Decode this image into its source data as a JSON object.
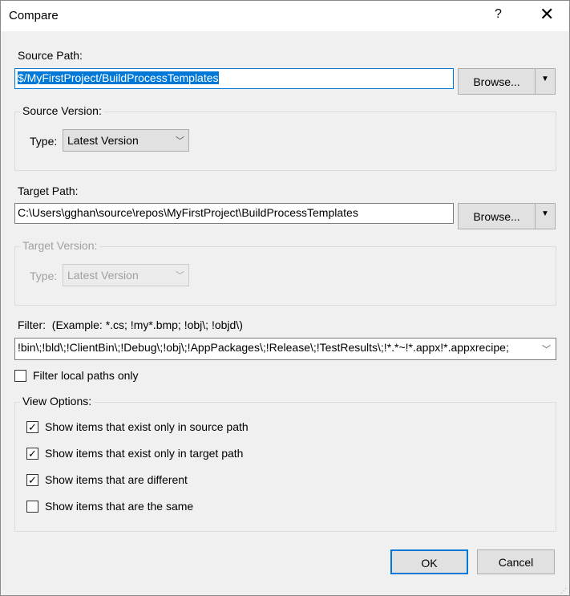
{
  "title": "Compare",
  "help": "?",
  "close": "✕",
  "source_path": {
    "label": "Source Path:",
    "value": "$/MyFirstProject/BuildProcessTemplates",
    "browse": "Browse..."
  },
  "source_version": {
    "legend": "Source Version:",
    "type_label": "Type:",
    "type_value": "Latest Version"
  },
  "target_path": {
    "label": "Target Path:",
    "value": "C:\\Users\\gghan\\source\\repos\\MyFirstProject\\BuildProcessTemplates",
    "browse": "Browse..."
  },
  "target_version": {
    "legend": "Target Version:",
    "type_label": "Type:",
    "type_value": "Latest Version"
  },
  "filter": {
    "label": "Filter:",
    "example": "(Example: *.cs; !my*.bmp; !obj\\; !objd\\)",
    "value": "!bin\\;!bld\\;!ClientBin\\;!Debug\\;!obj\\;!AppPackages\\;!Release\\;!TestResults\\;!*.*~!*.appx!*.appxrecipe;"
  },
  "filter_local": {
    "label": "Filter local paths only",
    "checked": false
  },
  "view_options": {
    "legend": "View Options:",
    "items": [
      {
        "label": "Show items that exist only in source path",
        "checked": true
      },
      {
        "label": "Show items that exist only in target path",
        "checked": true
      },
      {
        "label": "Show items that are different",
        "checked": true
      },
      {
        "label": "Show items that are the same",
        "checked": false
      }
    ]
  },
  "ok": "OK",
  "cancel": "Cancel"
}
